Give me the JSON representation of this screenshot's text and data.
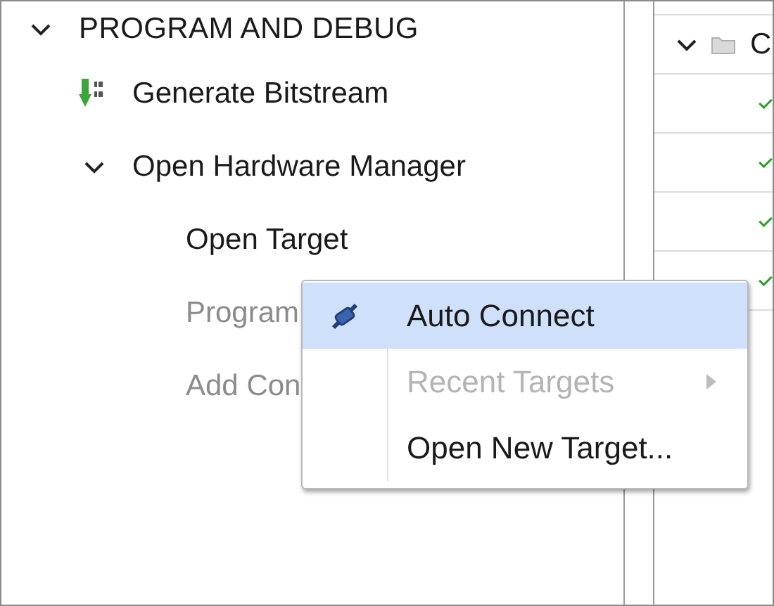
{
  "flow_tree": [
    {
      "label": "PROGRAM AND DEBUG",
      "kind": "section",
      "expanded": true,
      "disabled": false,
      "children": [
        {
          "label": "Generate Bitstream",
          "kind": "bitstream",
          "disabled": false
        },
        {
          "label": "Open Hardware Manager",
          "kind": "group",
          "expanded": true,
          "disabled": false,
          "children": [
            {
              "label": "Open Target",
              "kind": "item",
              "disabled": false
            },
            {
              "label": "Program",
              "kind": "item",
              "disabled": true
            },
            {
              "label": "Add Con",
              "kind": "item",
              "disabled": true
            }
          ]
        }
      ]
    }
  ],
  "right_panel": {
    "header": {
      "label": "C",
      "expanded": true
    },
    "rows": [
      {
        "complete": true
      },
      {
        "complete": true
      },
      {
        "complete": true
      },
      {
        "complete": true
      }
    ]
  },
  "context_menu": [
    {
      "label": "Auto Connect",
      "kind": "connect",
      "selected": true,
      "disabled": false
    },
    {
      "label": "Recent Targets",
      "kind": "submenu",
      "selected": false,
      "disabled": true
    },
    {
      "label": "Open New Target...",
      "kind": "action",
      "selected": false,
      "disabled": false
    }
  ]
}
